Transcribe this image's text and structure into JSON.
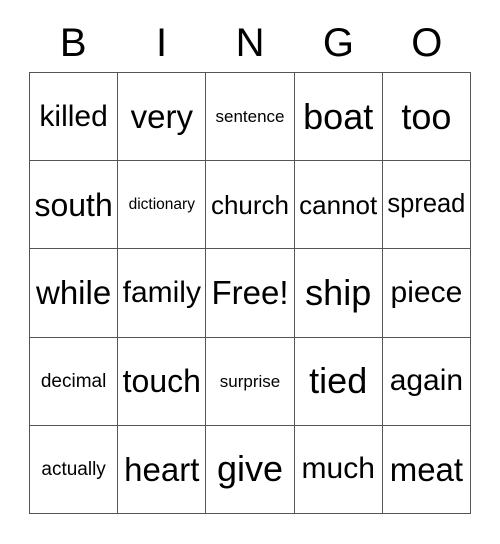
{
  "card": {
    "title": "BINGO",
    "header_letters": [
      "B",
      "I",
      "N",
      "G",
      "O"
    ],
    "free_space_label": "Free!",
    "grid_rows": 5,
    "grid_cols": 5,
    "border_color": "#555555",
    "text_color": "#000000",
    "background_color": "#ffffff",
    "rows": [
      {
        "cells": [
          {
            "text": "killed",
            "size": "l"
          },
          {
            "text": "very",
            "size": "xl"
          },
          {
            "text": "sentence",
            "size": "xxs"
          },
          {
            "text": "boat",
            "size": "xxl"
          },
          {
            "text": "too",
            "size": "xxl"
          }
        ]
      },
      {
        "cells": [
          {
            "text": "south",
            "size": "xl"
          },
          {
            "text": "dictionary",
            "size": "tiny"
          },
          {
            "text": "church",
            "size": "m"
          },
          {
            "text": "cannot",
            "size": "m"
          },
          {
            "text": "spread",
            "size": "m"
          }
        ]
      },
      {
        "cells": [
          {
            "text": "while",
            "size": "xl"
          },
          {
            "text": "family",
            "size": "l"
          },
          {
            "text": "Free!",
            "size": "xl"
          },
          {
            "text": "ship",
            "size": "xxl"
          },
          {
            "text": "piece",
            "size": "l"
          }
        ]
      },
      {
        "cells": [
          {
            "text": "decimal",
            "size": "xs"
          },
          {
            "text": "touch",
            "size": "xl"
          },
          {
            "text": "surprise",
            "size": "xxs"
          },
          {
            "text": "tied",
            "size": "xxl"
          },
          {
            "text": "again",
            "size": "l"
          }
        ]
      },
      {
        "cells": [
          {
            "text": "actually",
            "size": "xs"
          },
          {
            "text": "heart",
            "size": "xl"
          },
          {
            "text": "give",
            "size": "xxl"
          },
          {
            "text": "much",
            "size": "l"
          },
          {
            "text": "meat",
            "size": "xl"
          }
        ]
      }
    ]
  }
}
